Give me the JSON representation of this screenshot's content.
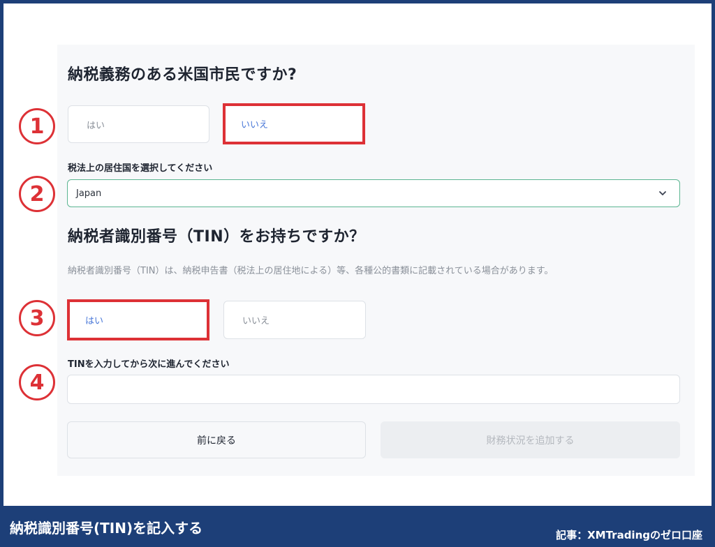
{
  "q1": {
    "heading": "納税義務のある米国市民ですか?",
    "options": [
      "はい",
      "いいえ"
    ]
  },
  "residence": {
    "label": "税法上の居住国を選択してください",
    "value": "Japan"
  },
  "q2": {
    "heading": "納税者識別番号（TIN）をお持ちですか？",
    "description": "納税者識別番号（TIN）は、納税申告書（税法上の居住地による）等、各種公的書類に記載されている場合があります。",
    "options": [
      "はい",
      "いいえ"
    ]
  },
  "tin": {
    "label": "TINを入力してから次に進んでください",
    "value": ""
  },
  "buttons": {
    "back": "前に戻る",
    "next": "財務状況を追加する"
  },
  "markers": [
    "1",
    "2",
    "3",
    "4"
  ],
  "footer": {
    "title": "納税識別番号(TIN)を記入する",
    "credit": "記事：XMTradingのゼロ口座"
  },
  "colors": {
    "frame": "#1d3f78",
    "highlight": "#dd3136",
    "selected_text": "#4a78d8",
    "select_border": "#5bb591"
  }
}
